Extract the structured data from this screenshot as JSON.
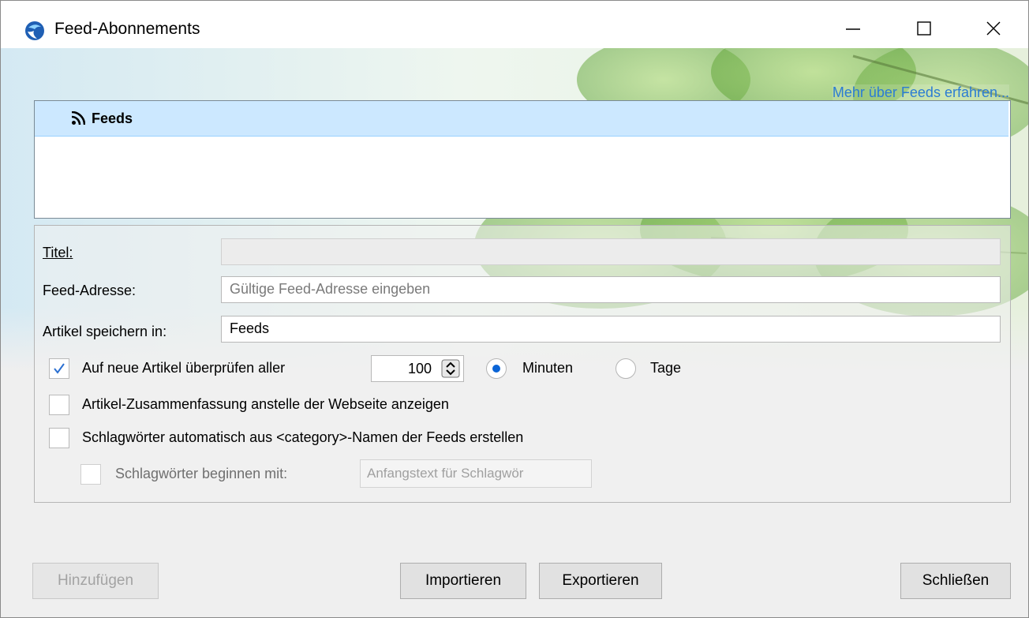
{
  "window": {
    "title": "Feed-Abonnements"
  },
  "header": {
    "more_link": "Mehr über Feeds erfahren..."
  },
  "tree": {
    "root_label": "Feeds"
  },
  "form": {
    "title_label": "Titel:",
    "title_value": "",
    "address_label": "Feed-Adresse:",
    "address_placeholder": "Gültige Feed-Adresse eingeben",
    "store_label": "Artikel speichern in:",
    "store_value": "Feeds",
    "check_new_label": "Auf neue Artikel überprüfen aller",
    "check_new_checked": true,
    "interval_value": "100",
    "unit_minutes": "Minuten",
    "unit_days": "Tage",
    "unit_selected": "Minuten",
    "summary_label": "Artikel-Zusammenfassung anstelle der Webseite anzeigen",
    "summary_checked": false,
    "autotag_label": "Schlagwörter automatisch aus <category>-Namen der Feeds erstellen",
    "autotag_checked": false,
    "prefix_label": "Schlagwörter beginnen mit:",
    "prefix_placeholder": "Anfangstext für Schlagwör"
  },
  "buttons": {
    "add": "Hinzufügen",
    "import": "Importieren",
    "export": "Exportieren",
    "close": "Schließen"
  },
  "colors": {
    "link": "#2b7cd3",
    "selection": "#cce8ff",
    "radio_accent": "#0a64d6"
  }
}
